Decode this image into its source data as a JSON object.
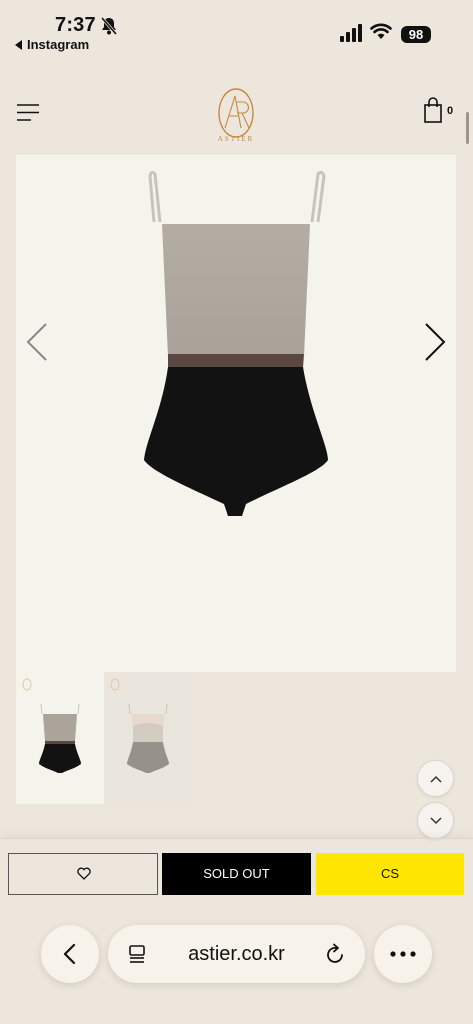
{
  "status_bar": {
    "time": "7:37",
    "back_app_label": "Instagram",
    "battery": "98",
    "icons": [
      "bell-slash-icon",
      "signal-icon",
      "wifi-icon",
      "battery-icon"
    ]
  },
  "header": {
    "logo_text": "ASTIER",
    "cart_count": "0",
    "icons": [
      "hamburger-menu-icon",
      "astier-logo",
      "shopping-bag-icon"
    ]
  },
  "gallery": {
    "image_alt": "Bodysuit with shimmering beige top and black bottom",
    "prev_icon": "chevron-left-icon",
    "next_icon": "chevron-right-icon",
    "thumbnails": [
      "thumbnail-black-beige",
      "thumbnail-grey-beige"
    ]
  },
  "actions": {
    "wishlist_icon": "heart-icon",
    "soldout_label": "SOLD OUT",
    "cs_label": "CS"
  },
  "browser": {
    "url": "astier.co.kr",
    "icons": [
      "back-chevron-icon",
      "page-icon",
      "reload-icon",
      "more-icon"
    ]
  },
  "colors": {
    "background": "#ede6dc",
    "image_bg": "#f4f3ec",
    "logo_gold": "#c58a3f",
    "cs_yellow": "#ffe600",
    "soldout_black": "#000000"
  }
}
